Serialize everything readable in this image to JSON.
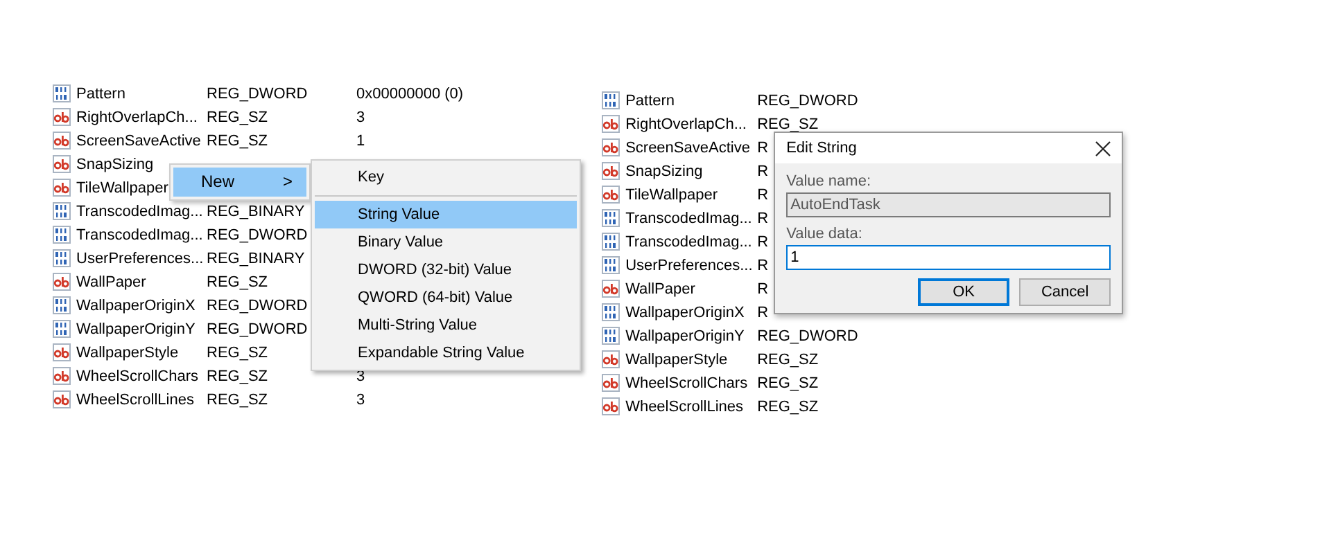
{
  "left_panel": {
    "rows": [
      {
        "kind": "binary",
        "name": "Pattern",
        "type": "REG_DWORD",
        "data": "0x00000000 (0)"
      },
      {
        "kind": "string",
        "name": "RightOverlapCh...",
        "type": "REG_SZ",
        "data": "3"
      },
      {
        "kind": "string",
        "name": "ScreenSaveActive",
        "type": "REG_SZ",
        "data": "1"
      },
      {
        "kind": "string",
        "name": "SnapSizing"
      },
      {
        "kind": "string",
        "name": "TileWallpaper"
      },
      {
        "kind": "binary",
        "name": "TranscodedImag...",
        "type": "REG_BINARY"
      },
      {
        "kind": "binary",
        "name": "TranscodedImag...",
        "type": "REG_DWORD"
      },
      {
        "kind": "binary",
        "name": "UserPreferences...",
        "type": "REG_BINARY"
      },
      {
        "kind": "string",
        "name": "WallPaper",
        "type": "REG_SZ"
      },
      {
        "kind": "binary",
        "name": "WallpaperOriginX",
        "type": "REG_DWORD"
      },
      {
        "kind": "binary",
        "name": "WallpaperOriginY",
        "type": "REG_DWORD"
      },
      {
        "kind": "string",
        "name": "WallpaperStyle",
        "type": "REG_SZ"
      },
      {
        "kind": "string",
        "name": "WheelScrollChars",
        "type": "REG_SZ",
        "data": "3"
      },
      {
        "kind": "string",
        "name": "WheelScrollLines",
        "type": "REG_SZ",
        "data": "3"
      }
    ],
    "context_menu": {
      "items": [
        {
          "label": "New",
          "arrow": ">",
          "selected": true
        }
      ]
    },
    "submenu": {
      "items": [
        {
          "kind": "item",
          "label": "Key",
          "selected": false
        },
        {
          "kind": "separator"
        },
        {
          "kind": "item",
          "label": "String Value",
          "selected": true
        },
        {
          "kind": "item",
          "label": "Binary Value",
          "selected": false
        },
        {
          "kind": "item",
          "label": "DWORD (32-bit) Value",
          "selected": false
        },
        {
          "kind": "item",
          "label": "QWORD (64-bit) Value",
          "selected": false
        },
        {
          "kind": "item",
          "label": "Multi-String Value",
          "selected": false
        },
        {
          "kind": "item",
          "label": "Expandable String Value",
          "selected": false
        }
      ]
    }
  },
  "right_panel": {
    "rows": [
      {
        "kind": "binary",
        "name": "Pattern",
        "type": "REG_DWORD"
      },
      {
        "kind": "string",
        "name": "RightOverlapCh...",
        "type": "REG_SZ"
      },
      {
        "kind": "string",
        "name": "ScreenSaveActive",
        "type": "R"
      },
      {
        "kind": "string",
        "name": "SnapSizing",
        "type": "R"
      },
      {
        "kind": "string",
        "name": "TileWallpaper",
        "type": "R"
      },
      {
        "kind": "binary",
        "name": "TranscodedImag...",
        "type": "R"
      },
      {
        "kind": "binary",
        "name": "TranscodedImag...",
        "type": "R"
      },
      {
        "kind": "binary",
        "name": "UserPreferences...",
        "type": "R"
      },
      {
        "kind": "string",
        "name": "WallPaper",
        "type": "R"
      },
      {
        "kind": "binary",
        "name": "WallpaperOriginX",
        "type": "R"
      },
      {
        "kind": "binary",
        "name": "WallpaperOriginY",
        "type": "REG_DWORD"
      },
      {
        "kind": "string",
        "name": "WallpaperStyle",
        "type": "REG_SZ"
      },
      {
        "kind": "string",
        "name": "WheelScrollChars",
        "type": "REG_SZ"
      },
      {
        "kind": "string",
        "name": "WheelScrollLines",
        "type": "REG_SZ"
      }
    ],
    "dialog": {
      "title": "Edit String",
      "value_name_label": "Value name:",
      "value_name": "AutoEndTask",
      "value_data_label": "Value data:",
      "value_data": "1",
      "buttons": [
        {
          "label": "OK",
          "default": true
        },
        {
          "label": "Cancel",
          "default": false
        }
      ]
    }
  }
}
